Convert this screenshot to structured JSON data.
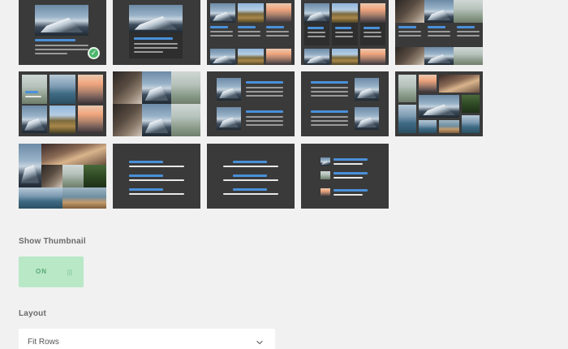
{
  "layout_tiles": [
    {
      "name": "layout-option-1",
      "selected": true
    },
    {
      "name": "layout-option-2",
      "selected": false
    },
    {
      "name": "layout-option-3",
      "selected": false
    },
    {
      "name": "layout-option-4",
      "selected": false
    },
    {
      "name": "layout-option-5",
      "selected": false
    },
    {
      "name": "layout-option-6",
      "selected": false
    },
    {
      "name": "layout-option-7",
      "selected": false
    },
    {
      "name": "layout-option-8",
      "selected": false
    },
    {
      "name": "layout-option-9",
      "selected": false
    },
    {
      "name": "layout-option-10",
      "selected": false
    },
    {
      "name": "layout-option-11",
      "selected": false
    },
    {
      "name": "layout-option-12",
      "selected": false
    },
    {
      "name": "layout-option-13",
      "selected": false
    },
    {
      "name": "layout-option-14",
      "selected": false
    }
  ],
  "selected_icon": "check-icon",
  "show_thumbnail": {
    "label": "Show Thumbnail",
    "toggle_text": "ON",
    "grip": "|||",
    "state": "on"
  },
  "layout": {
    "label": "Layout",
    "selected_value": "Fit Rows",
    "chevron_icon": "chevron-down-icon"
  },
  "colors": {
    "accent": "#4a90d9",
    "toggle_bg": "#b9e8c7",
    "toggle_text": "#5aa873",
    "check": "#4cb66a"
  }
}
